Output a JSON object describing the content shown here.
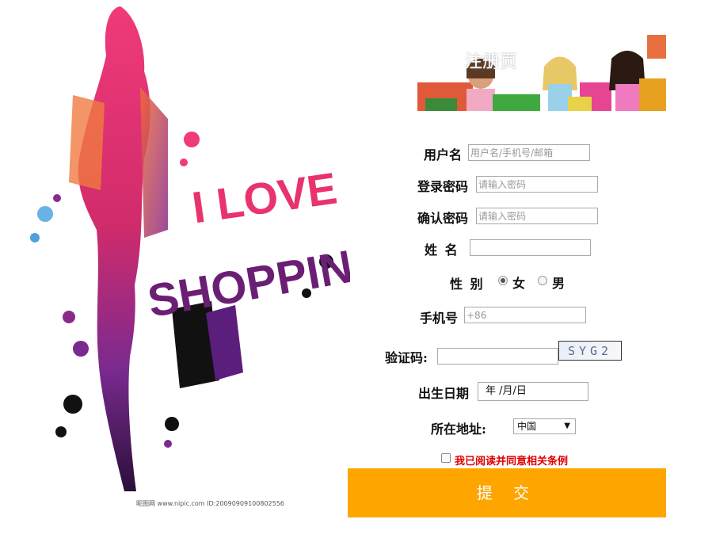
{
  "banner": {
    "title": "注册页"
  },
  "poster": {
    "line1": "I LOVE",
    "line2": "SHOPPING",
    "caption": "昵图网 www.nipic.com  ID:20090909100802556"
  },
  "form": {
    "username": {
      "label": "用户名",
      "placeholder": "用户名/手机号/邮箱"
    },
    "password": {
      "label": "登录密码",
      "placeholder": "请输入密码"
    },
    "confirm": {
      "label": "确认密码",
      "placeholder": "请输入密码"
    },
    "name": {
      "label": "姓 名",
      "value": ""
    },
    "gender": {
      "label": "性 别",
      "options": [
        "女",
        "男"
      ],
      "selected": "女"
    },
    "phone": {
      "label": "手机号",
      "placeholder": "+86"
    },
    "captcha": {
      "label": "验证码:",
      "code": "SYG2"
    },
    "birthday": {
      "label": "出生日期",
      "value": "年 /月/日"
    },
    "location": {
      "label": "所在地址:",
      "selected": "中国"
    },
    "terms": {
      "label": "我已阅读并同意相关条例",
      "checked": false
    },
    "submit_label": "提 交"
  },
  "colors": {
    "accent": "#ffa500",
    "terms": "#e00000",
    "poster_pink": "#e8336d",
    "poster_purple": "#5b1e7d"
  }
}
